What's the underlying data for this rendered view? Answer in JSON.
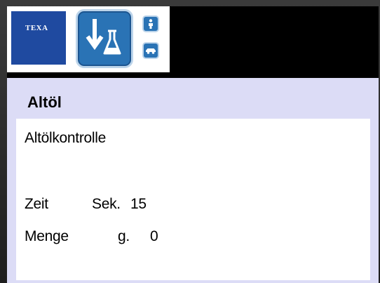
{
  "header": {
    "brand": "TEXA",
    "icons": {
      "main": "oil-drain-flask-icon",
      "top": "person-icon",
      "bottom": "car-icon"
    }
  },
  "content": {
    "title": "Altöl",
    "subtitle": "Altölkontrolle",
    "rows": [
      {
        "label": "Zeit",
        "unit": "Sek.",
        "value": "15"
      },
      {
        "label": "Menge",
        "unit": "g.",
        "value": "0"
      }
    ]
  },
  "colors": {
    "brand_blue": "#1f4aa0",
    "icon_blue": "#2a73b5",
    "content_background": "#dcdcf6",
    "header_background": "#000000"
  }
}
